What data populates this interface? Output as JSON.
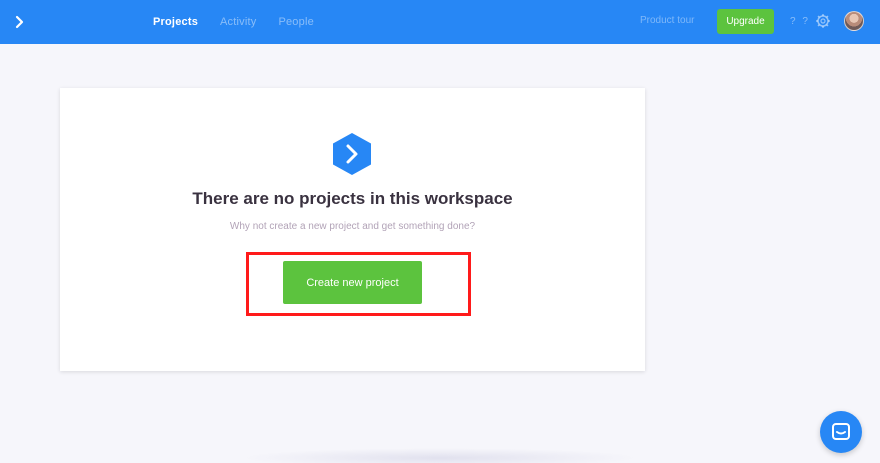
{
  "topbar": {
    "nav": [
      {
        "label": "Projects",
        "active": true
      },
      {
        "label": "Activity",
        "active": false
      },
      {
        "label": "People",
        "active": false
      }
    ],
    "product_tour": "Product tour",
    "upgrade_label": "Upgrade",
    "help_label": "? ?",
    "accent_color": "#2787f5"
  },
  "main": {
    "empty_title": "There are no projects in this workspace",
    "empty_subtitle": "Why not create a new project and get something done?",
    "create_button_label": "Create new project",
    "button_color": "#5cc33e",
    "highlight_color": "#ff1a1a"
  },
  "icons": {
    "logo": "chevron-right-icon",
    "settings": "gear-icon",
    "chat": "chat-icon"
  }
}
